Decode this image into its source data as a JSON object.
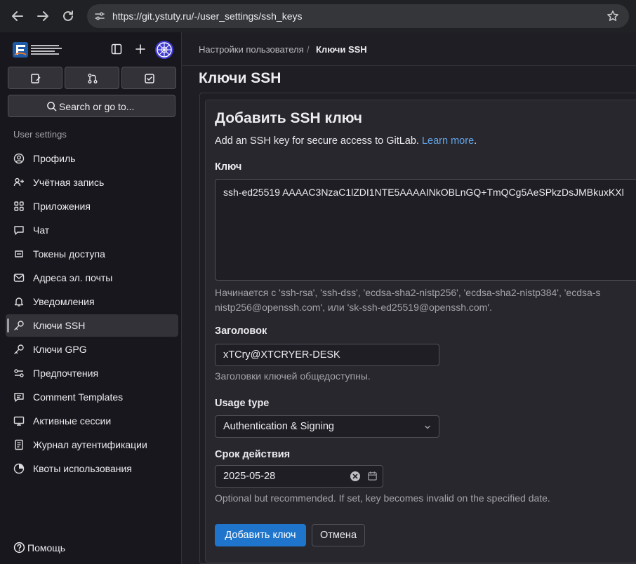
{
  "browser": {
    "url": "https://git.ystuty.ru/-/user_settings/ssh_keys",
    "icons": [
      "back-icon",
      "forward-icon",
      "reload-icon",
      "site-settings-icon",
      "bookmark-star-icon"
    ]
  },
  "sidebar": {
    "search_label": "Search or go to...",
    "section_title": "User settings",
    "items": [
      {
        "label": "Профиль",
        "icon": "profile-icon"
      },
      {
        "label": "Учётная запись",
        "icon": "account-icon"
      },
      {
        "label": "Приложения",
        "icon": "applications-icon"
      },
      {
        "label": "Чат",
        "icon": "chat-icon"
      },
      {
        "label": "Токены доступа",
        "icon": "token-icon"
      },
      {
        "label": "Адреса эл. почты",
        "icon": "mail-icon"
      },
      {
        "label": "Уведомления",
        "icon": "bell-icon"
      },
      {
        "label": "Ключи SSH",
        "icon": "key-icon",
        "active": true
      },
      {
        "label": "Ключи GPG",
        "icon": "key-icon"
      },
      {
        "label": "Предпочтения",
        "icon": "preferences-icon"
      },
      {
        "label": "Comment Templates",
        "icon": "comment-templates-icon"
      },
      {
        "label": "Активные сессии",
        "icon": "monitor-icon"
      },
      {
        "label": "Журнал аутентификации",
        "icon": "log-icon"
      },
      {
        "label": "Квоты использования",
        "icon": "quota-icon"
      }
    ],
    "help_label": "Помощь"
  },
  "breadcrumb": {
    "parent": "Настройки пользователя",
    "separator": "/",
    "current": "Ключи SSH"
  },
  "page": {
    "title": "Ключи SSH"
  },
  "form": {
    "title": "Добавить SSH ключ",
    "description": "Add an SSH key for secure access to GitLab.",
    "learn_more": "Learn more",
    "description_end": ".",
    "key_label": "Ключ",
    "key_value": "ssh-ed25519 AAAAC3NzaC1lZDI1NTE5AAAAINkOBLnGQ+TmQCg5AeSPkzDsJMBkuxKXl",
    "key_help_line1": "Начинается с 'ssh-rsa', 'ssh-dss', 'ecdsa-sha2-nistp256', 'ecdsa-sha2-nistp384', 'ecdsa-s",
    "key_help_line2": "nistp256@openssh.com', или 'sk-ssh-ed25519@openssh.com'.",
    "title_label": "Заголовок",
    "title_value": "xTCry@XTCRYER-DESK",
    "title_help": "Заголовки ключей общедоступны.",
    "usage_label": "Usage type",
    "usage_value": "Authentication & Signing",
    "expiry_label": "Срок действия",
    "expiry_value": "2025-05-28",
    "expiry_help": "Optional but recommended. If set, key becomes invalid on the specified date.",
    "submit_label": "Добавить ключ",
    "cancel_label": "Отмена"
  },
  "colors": {
    "primary_button": "#1f75cb",
    "link": "#63a6e9",
    "sidebar_bg": "#18171d",
    "content_bg": "#1f1e24"
  }
}
